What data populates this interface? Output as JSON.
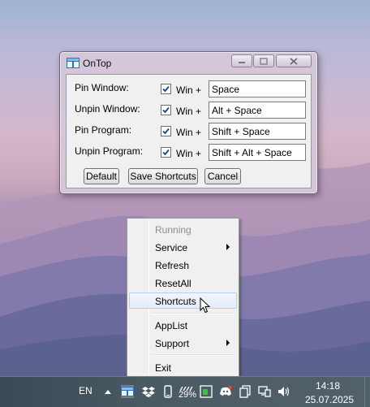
{
  "window": {
    "title": "OnTop",
    "rows": [
      {
        "label": "Pin Window:",
        "checked": true,
        "modifier": "Win",
        "plus": "+",
        "value": "Space"
      },
      {
        "label": "Unpin Window:",
        "checked": true,
        "modifier": "Win",
        "plus": "+",
        "value": "Alt + Space"
      },
      {
        "label": "Pin Program:",
        "checked": true,
        "modifier": "Win",
        "plus": "+",
        "value": "Shift + Space"
      },
      {
        "label": "Unpin Program:",
        "checked": true,
        "modifier": "Win",
        "plus": "+",
        "value": "Shift + Alt + Space"
      }
    ],
    "buttons": {
      "default": "Default",
      "save": "Save Shortcuts",
      "cancel": "Cancel"
    }
  },
  "menu": {
    "items": [
      {
        "label": "Running",
        "disabled": true
      },
      {
        "label": "Service",
        "submenu": true
      },
      {
        "label": "Refresh"
      },
      {
        "label": "ResetAll"
      },
      {
        "label": "Shortcuts",
        "highlighted": true
      },
      {
        "label": "AppList"
      },
      {
        "label": "Support",
        "submenu": true
      },
      {
        "label": "Exit"
      }
    ]
  },
  "taskbar": {
    "language": "EN",
    "battery_text": "29%",
    "time": "14:18",
    "date": "25.07.2025",
    "tray_icons": [
      "show-hidden-icon",
      "ontop-tray-icon",
      "dropbox-icon",
      "phone-icon",
      "battery-icon",
      "green-app-icon",
      "discord-icon",
      "copy-icon",
      "network-icon",
      "volume-icon"
    ]
  },
  "colors": {
    "menu_highlight": "#e3edf8",
    "highlight_border": "#aecff7",
    "taskbar": "#3a4a55"
  }
}
